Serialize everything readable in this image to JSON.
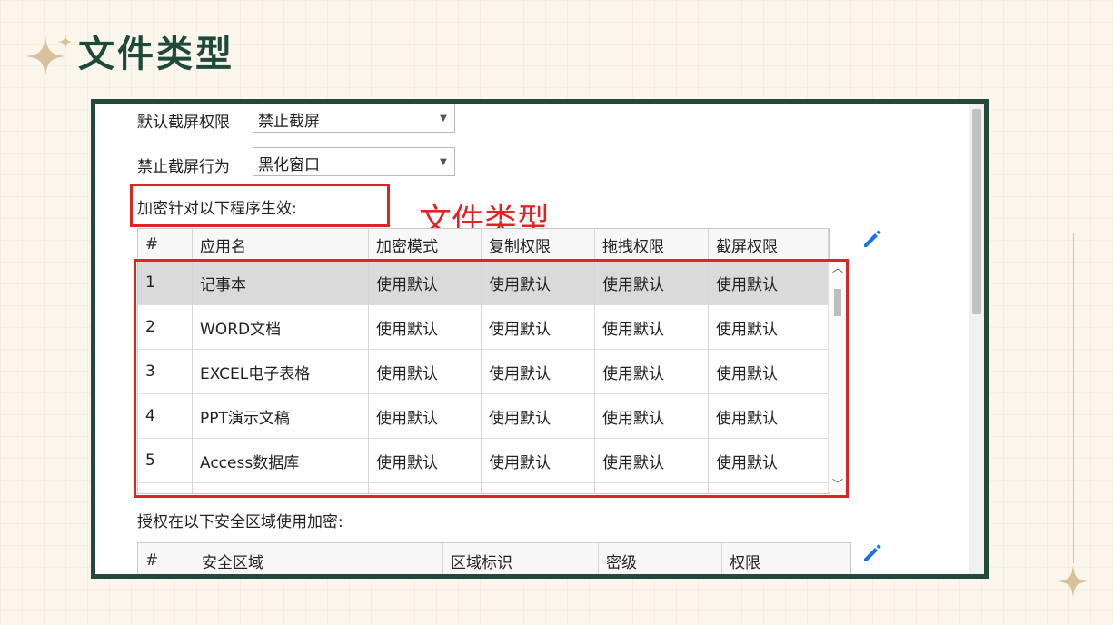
{
  "slide": {
    "title": "文件类型"
  },
  "settings": {
    "screenshot_permission": {
      "label": "默认截屏权限",
      "value": "禁止截屏"
    },
    "screenshot_behavior": {
      "label": "禁止截屏行为",
      "value": "黑化窗口"
    },
    "programs_label": "加密针对以下程序生效:",
    "zones_label": "授权在以下安全区域使用加密:"
  },
  "annotation": {
    "text": "文件类型",
    "color": "#e02424"
  },
  "programs_table": {
    "columns": [
      "#",
      "应用名",
      "加密模式",
      "复制权限",
      "拖拽权限",
      "截屏权限"
    ],
    "rows": [
      [
        "1",
        "记事本",
        "使用默认",
        "使用默认",
        "使用默认",
        "使用默认"
      ],
      [
        "2",
        "WORD文档",
        "使用默认",
        "使用默认",
        "使用默认",
        "使用默认"
      ],
      [
        "3",
        "EXCEL电子表格",
        "使用默认",
        "使用默认",
        "使用默认",
        "使用默认"
      ],
      [
        "4",
        "PPT演示文稿",
        "使用默认",
        "使用默认",
        "使用默认",
        "使用默认"
      ],
      [
        "5",
        "Access数据库",
        "使用默认",
        "使用默认",
        "使用默认",
        "使用默认"
      ]
    ],
    "selected_row": 1
  },
  "zones_table": {
    "columns": [
      "#",
      "安全区域",
      "区域标识",
      "密级",
      "权限"
    ]
  },
  "icons": {
    "edit": "pencil-icon",
    "sparkle": "four-point-star-icon"
  },
  "colors": {
    "title": "#1e4a3a",
    "frame": "#24483a",
    "accent_blue": "#1a73e8",
    "highlight": "#e02424"
  }
}
